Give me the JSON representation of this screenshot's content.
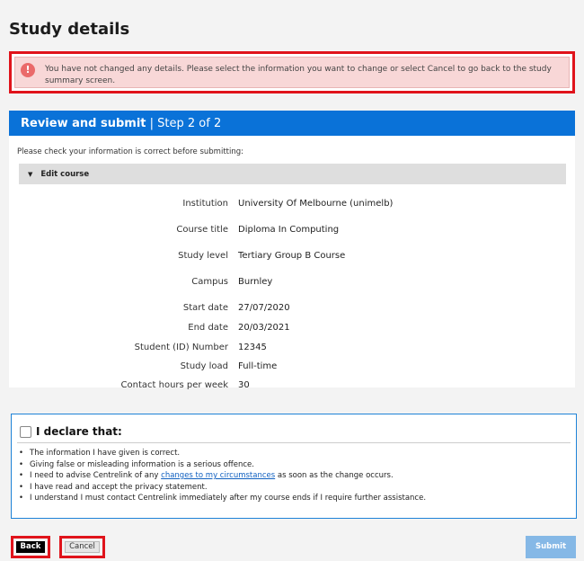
{
  "page": {
    "title": "Study details"
  },
  "alert": {
    "icon": "exclamation-icon",
    "message": "You have not changed any details. Please select the information you want to change or select Cancel to go back to the study summary screen."
  },
  "panel": {
    "title": "Review and submit",
    "step": "Step 2 of 2",
    "intro": "Please check your information is correct before submitting:",
    "section_label": "Edit course",
    "rows": [
      {
        "label": "Institution",
        "value": "University Of Melbourne (unimelb)"
      },
      {
        "label": "Course title",
        "value": "Diploma In Computing"
      },
      {
        "label": "Study level",
        "value": "Tertiary Group B Course"
      },
      {
        "label": "Campus",
        "value": "Burnley"
      },
      {
        "label": "Start date",
        "value": "27/07/2020"
      },
      {
        "label": "End date",
        "value": "20/03/2021"
      },
      {
        "label": "Student (ID) Number",
        "value": "12345"
      },
      {
        "label": "Study load",
        "value": "Full-time"
      },
      {
        "label": "Contact hours per week",
        "value": "30"
      }
    ]
  },
  "declaration": {
    "title": "I declare that:",
    "items": [
      "The information I have given is correct.",
      "Giving false or misleading information is a serious offence."
    ],
    "item3_before": "I need to advise Centrelink of any ",
    "item3_link": "changes to my circumstances",
    "item3_after": " as soon as the change occurs.",
    "item4": "I have read and accept the privacy statement.",
    "item5": "I understand I must contact Centrelink immediately after my course ends if I require further assistance."
  },
  "buttons": {
    "back": "Back",
    "cancel": "Cancel",
    "submit": "Submit"
  },
  "colors": {
    "accent": "#0a72d8",
    "error": "#e0131b",
    "error_bg": "#f8d7d7",
    "submit_disabled": "#85b8e6"
  }
}
